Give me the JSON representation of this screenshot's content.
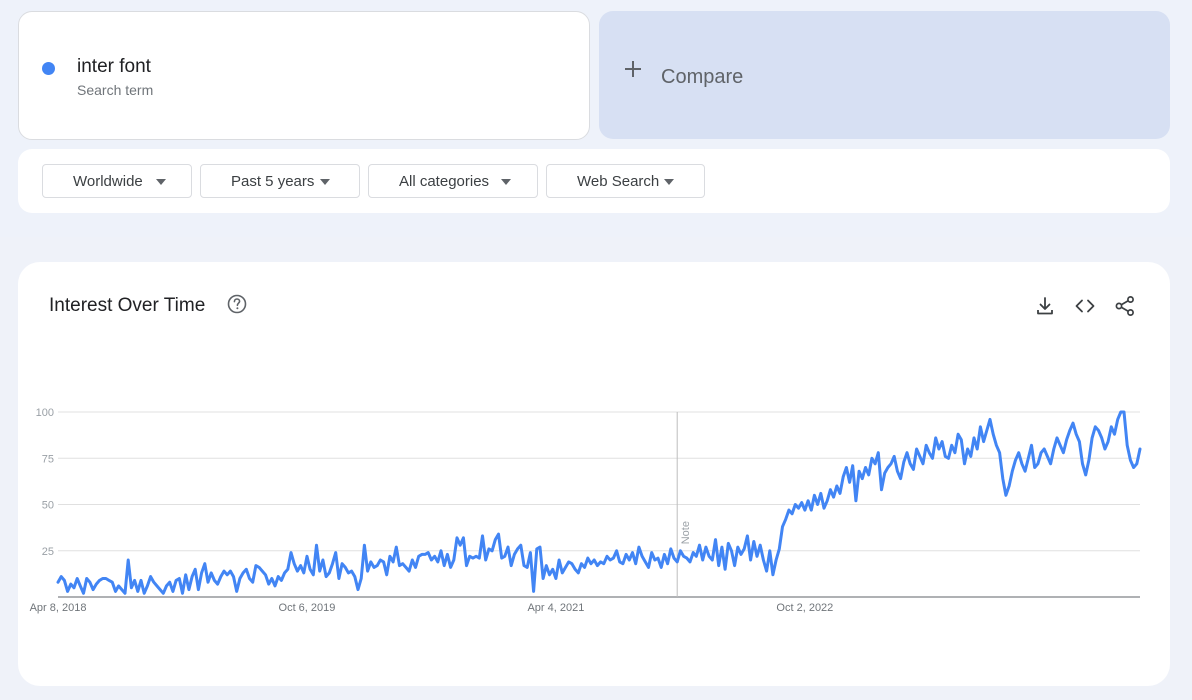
{
  "search": {
    "term": "inter font",
    "term_sublabel": "Search term",
    "term_color": "#4285f4",
    "compare_label": "Compare"
  },
  "filters": [
    {
      "label": "Worldwide"
    },
    {
      "label": "Past 5 years"
    },
    {
      "label": "All categories"
    },
    {
      "label": "Web Search"
    }
  ],
  "card": {
    "title": "Interest Over Time",
    "icons": [
      "help-icon",
      "download-icon",
      "embed-code-icon",
      "share-icon"
    ]
  },
  "chart_data": {
    "type": "line",
    "title": "Interest Over Time",
    "xlabel": "",
    "ylabel": "",
    "ylim": [
      0,
      100
    ],
    "yticks": [
      25,
      50,
      75,
      100
    ],
    "grid": true,
    "line_color": "#4285f4",
    "x_tick_labels": [
      {
        "label": "Apr 8, 2018",
        "week_index": 0
      },
      {
        "label": "Oct 6, 2019",
        "week_index": 78
      },
      {
        "label": "Apr 4, 2021",
        "week_index": 156
      },
      {
        "label": "Oct 2, 2022",
        "week_index": 234
      }
    ],
    "annotations": [
      {
        "label": "Note",
        "week_index": 194
      }
    ],
    "series": [
      {
        "values": [
          8,
          11,
          9,
          3,
          7,
          5,
          10,
          6,
          2,
          10,
          8,
          4,
          7,
          9,
          10,
          10,
          9,
          8,
          3,
          6,
          4,
          2,
          20,
          5,
          9,
          3,
          9,
          2,
          6,
          11,
          8,
          6,
          4,
          2,
          6,
          8,
          3,
          9,
          10,
          2,
          12,
          4,
          11,
          15,
          4,
          13,
          18,
          8,
          13,
          9,
          7,
          11,
          14,
          12,
          14,
          11,
          3,
          10,
          13,
          15,
          10,
          8,
          17,
          16,
          14,
          12,
          7,
          10,
          6,
          11,
          9,
          13,
          15,
          24,
          18,
          14,
          17,
          13,
          22,
          15,
          12,
          28,
          14,
          20,
          11,
          13,
          18,
          24,
          10,
          18,
          16,
          13,
          14,
          11,
          4,
          10,
          28,
          14,
          19,
          16,
          17,
          20,
          19,
          12,
          22,
          19,
          27,
          17,
          18,
          16,
          14,
          20,
          16,
          22,
          23,
          23,
          24,
          20,
          22,
          19,
          25,
          17,
          23,
          16,
          20,
          32,
          28,
          32,
          17,
          22,
          21,
          22,
          21,
          33,
          20,
          26,
          25,
          31,
          34,
          21,
          22,
          27,
          17,
          23,
          26,
          28,
          17,
          16,
          24,
          3,
          26,
          27,
          10,
          17,
          12,
          15,
          10,
          20,
          13,
          16,
          19,
          18,
          15,
          13,
          18,
          16,
          21,
          18,
          20,
          17,
          19,
          18,
          22,
          20,
          21,
          25,
          19,
          18,
          23,
          20,
          24,
          18,
          27,
          22,
          19,
          16,
          24,
          20,
          21,
          16,
          23,
          18,
          26,
          21,
          19,
          25,
          22,
          21,
          19,
          24,
          22,
          28,
          20,
          27,
          22,
          20,
          31,
          17,
          27,
          15,
          29,
          25,
          17,
          27,
          23,
          26,
          33,
          20,
          30,
          22,
          28,
          20,
          14,
          25,
          12,
          20,
          26,
          38,
          42,
          47,
          45,
          50,
          48,
          51,
          47,
          52,
          47,
          55,
          50,
          56,
          48,
          52,
          58,
          54,
          60,
          56,
          65,
          70,
          62,
          71,
          52,
          68,
          64,
          70,
          66,
          75,
          72,
          78,
          58,
          67,
          70,
          72,
          76,
          68,
          64,
          73,
          78,
          72,
          69,
          80,
          76,
          72,
          82,
          78,
          75,
          86,
          80,
          84,
          76,
          75,
          82,
          78,
          88,
          85,
          72,
          80,
          76,
          86,
          80,
          92,
          84,
          90,
          96,
          88,
          82,
          78,
          64,
          55,
          60,
          68,
          74,
          78,
          72,
          68,
          75,
          82,
          70,
          72,
          78,
          80,
          76,
          72,
          80,
          86,
          82,
          78,
          85,
          90,
          94,
          88,
          84,
          72,
          66,
          74,
          86,
          92,
          90,
          86,
          80,
          84,
          92,
          88,
          96,
          100,
          100,
          82,
          74,
          70,
          72,
          80
        ]
      }
    ]
  }
}
